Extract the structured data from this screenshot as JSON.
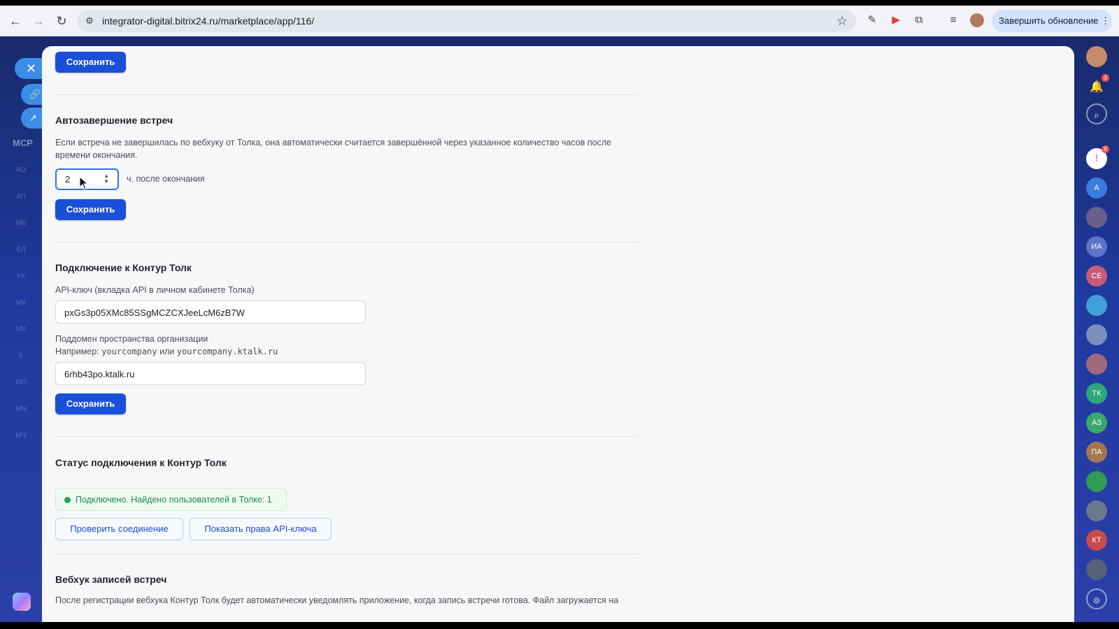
{
  "browser": {
    "url": "integrator-digital.bitrix24.ru/marketplace/app/116/",
    "update_button": "Завершить обновление ⋮"
  },
  "left_rail": {
    "mcp_label": "МСР",
    "faded_labels": [
      "АО",
      "АП",
      "МБ",
      "БЛ",
      "УК",
      "МК",
      "МК",
      "К",
      "МП",
      "МЧ",
      "МЧ"
    ]
  },
  "main": {
    "save_label": "Сохранить",
    "autocomplete": {
      "title": "Автозавершение встреч",
      "description_line1": "Если встреча не завершилась по вебхуку от Толка, она автоматически считается завершённой через указанное количество часов после",
      "description_line2": "времени окончания.",
      "hours_value": "2",
      "hours_suffix": "ч. после окончания"
    },
    "connection": {
      "title": "Подключение к Контур Толк",
      "api_key_label": "API-ключ (вкладка API в личном кабинете Толка)",
      "api_key_value": "pxGs3p05XMc85SSgMCZCXJeeLcM6zB7W",
      "subdomain_label": "Поддомен пространства организации",
      "example_prefix": "Например:",
      "example_1": "yourcompany",
      "example_or": "или",
      "example_2": "yourcompany.ktalk.ru",
      "subdomain_value": "6rhb43po.ktalk.ru"
    },
    "status": {
      "title": "Статус подключения к Контур Толк",
      "message": "Подключено. Найдено пользователей в Толке: 1",
      "check_button": "Проверить соединение",
      "rights_button": "Показать права API-ключа"
    },
    "webhook": {
      "title": "Вебхук записей встреч",
      "description": "После регистрации вебхука Контур Толк будет автоматически уведомлять приложение, когда запись встречи готова. Файл загружается на"
    }
  },
  "right_rail": {
    "notifications_badge": "3",
    "counter_badge": "8",
    "avatars": [
      "А",
      "",
      "ИА",
      "СЕ",
      "",
      "",
      "",
      "ТК",
      "АЗ",
      "ПА",
      "",
      "",
      "КТ",
      ""
    ]
  }
}
